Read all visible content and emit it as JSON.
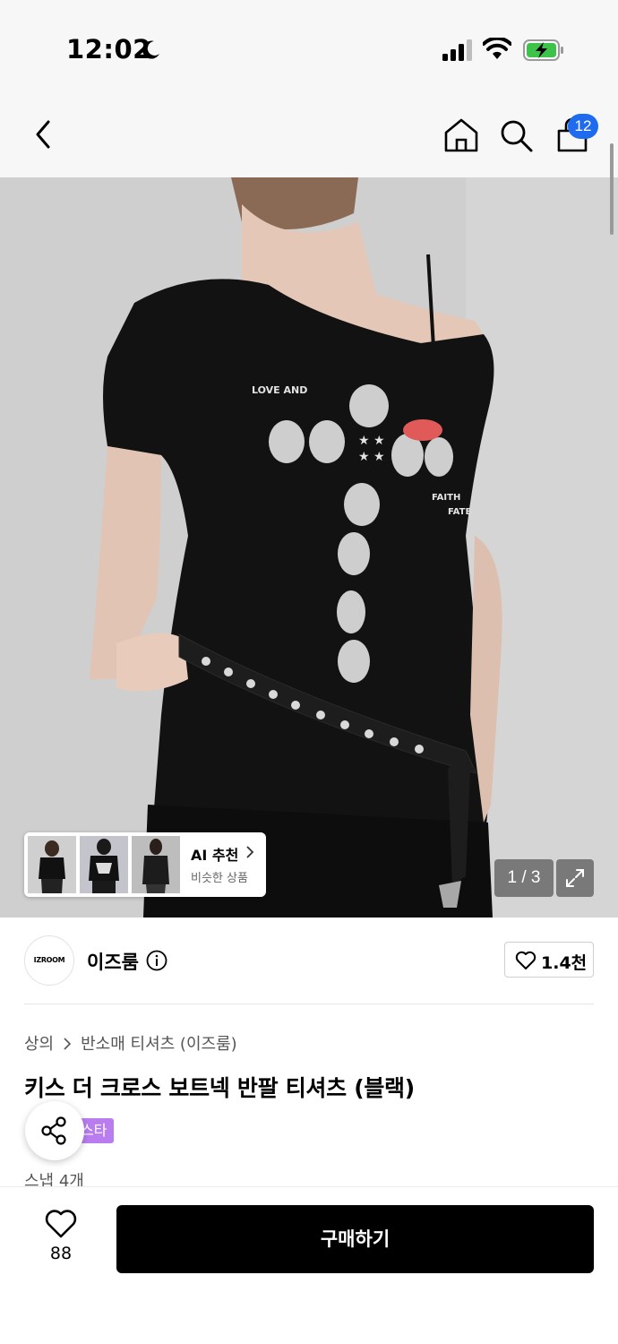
{
  "status_bar": {
    "time": "12:02"
  },
  "nav": {
    "cart_count": "12"
  },
  "hero": {
    "print_text": "LOVE AND",
    "print_text_2": "FAITH",
    "print_text_3": "FATE",
    "page_indicator": "1 / 3"
  },
  "ai_recommend": {
    "title": "AI 추천",
    "subtitle": "비슷한 상품"
  },
  "brand": {
    "logo_text": "IZROOM",
    "name": "이즈룸",
    "likes": "1.4천"
  },
  "product": {
    "breadcrumb": [
      "상의",
      "반소매 티셔츠 (이즈룸)"
    ],
    "title": "키스 더 크로스 보트넥 반팔 티셔츠 (블랙)",
    "tag": "스타",
    "snap": "스냅 4개"
  },
  "bottom": {
    "wish_count": "88",
    "buy_label": "구매하기"
  },
  "colors": {
    "badge": "#1f6bf0",
    "tag": "#b97df0",
    "buy": "#000000"
  }
}
